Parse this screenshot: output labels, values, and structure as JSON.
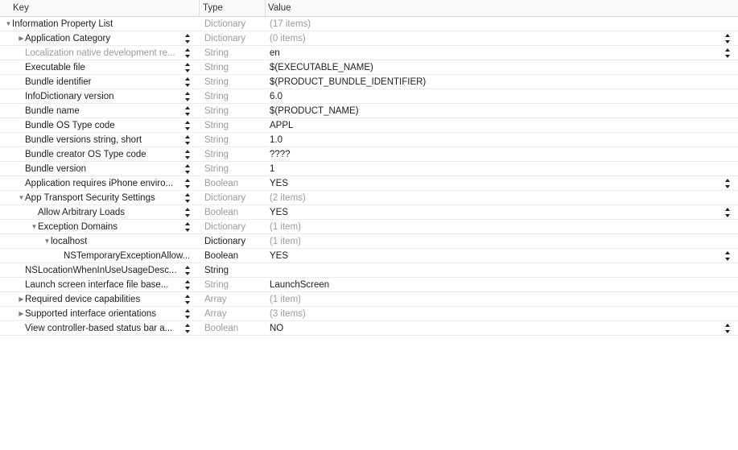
{
  "columns": {
    "key": "Key",
    "type": "Type",
    "value": "Value"
  },
  "rows": [
    {
      "key": "Information Property List",
      "type": "Dictionary",
      "value": "(17 items)",
      "level": 0,
      "disclosure": "expanded",
      "key_stepper": false,
      "value_stepper": false,
      "key_muted": false,
      "type_dark": false,
      "value_muted": true
    },
    {
      "key": "Application Category",
      "type": "Dictionary",
      "value": "(0 items)",
      "level": 1,
      "disclosure": "collapsed",
      "key_stepper": true,
      "value_stepper": true,
      "key_muted": false,
      "type_dark": false,
      "value_muted": true
    },
    {
      "key": "Localization native development re...",
      "type": "String",
      "value": "en",
      "level": 1,
      "disclosure": "none",
      "key_stepper": true,
      "value_stepper": true,
      "key_muted": true,
      "type_dark": false,
      "value_muted": false
    },
    {
      "key": "Executable file",
      "type": "String",
      "value": "$(EXECUTABLE_NAME)",
      "level": 1,
      "disclosure": "none",
      "key_stepper": true,
      "value_stepper": false,
      "key_muted": false,
      "type_dark": false,
      "value_muted": false
    },
    {
      "key": "Bundle identifier",
      "type": "String",
      "value": "$(PRODUCT_BUNDLE_IDENTIFIER)",
      "level": 1,
      "disclosure": "none",
      "key_stepper": true,
      "value_stepper": false,
      "key_muted": false,
      "type_dark": false,
      "value_muted": false
    },
    {
      "key": "InfoDictionary version",
      "type": "String",
      "value": "6.0",
      "level": 1,
      "disclosure": "none",
      "key_stepper": true,
      "value_stepper": false,
      "key_muted": false,
      "type_dark": false,
      "value_muted": false
    },
    {
      "key": "Bundle name",
      "type": "String",
      "value": "$(PRODUCT_NAME)",
      "level": 1,
      "disclosure": "none",
      "key_stepper": true,
      "value_stepper": false,
      "key_muted": false,
      "type_dark": false,
      "value_muted": false
    },
    {
      "key": "Bundle OS Type code",
      "type": "String",
      "value": "APPL",
      "level": 1,
      "disclosure": "none",
      "key_stepper": true,
      "value_stepper": false,
      "key_muted": false,
      "type_dark": false,
      "value_muted": false
    },
    {
      "key": "Bundle versions string, short",
      "type": "String",
      "value": "1.0",
      "level": 1,
      "disclosure": "none",
      "key_stepper": true,
      "value_stepper": false,
      "key_muted": false,
      "type_dark": false,
      "value_muted": false
    },
    {
      "key": "Bundle creator OS Type code",
      "type": "String",
      "value": "????",
      "level": 1,
      "disclosure": "none",
      "key_stepper": true,
      "value_stepper": false,
      "key_muted": false,
      "type_dark": false,
      "value_muted": false
    },
    {
      "key": "Bundle version",
      "type": "String",
      "value": "1",
      "level": 1,
      "disclosure": "none",
      "key_stepper": true,
      "value_stepper": false,
      "key_muted": false,
      "type_dark": false,
      "value_muted": false
    },
    {
      "key": "Application requires iPhone enviro...",
      "type": "Boolean",
      "value": "YES",
      "level": 1,
      "disclosure": "none",
      "key_stepper": true,
      "value_stepper": true,
      "key_muted": false,
      "type_dark": false,
      "value_muted": false
    },
    {
      "key": "App Transport Security Settings",
      "type": "Dictionary",
      "value": "(2 items)",
      "level": 1,
      "disclosure": "expanded",
      "key_stepper": true,
      "value_stepper": false,
      "key_muted": false,
      "type_dark": false,
      "value_muted": true
    },
    {
      "key": "Allow Arbitrary Loads",
      "type": "Boolean",
      "value": "YES",
      "level": 2,
      "disclosure": "none",
      "key_stepper": true,
      "value_stepper": true,
      "key_muted": false,
      "type_dark": false,
      "value_muted": false
    },
    {
      "key": "Exception Domains",
      "type": "Dictionary",
      "value": "(1 item)",
      "level": 2,
      "disclosure": "expanded",
      "key_stepper": true,
      "value_stepper": false,
      "key_muted": false,
      "type_dark": false,
      "value_muted": true
    },
    {
      "key": "localhost",
      "type": "Dictionary",
      "value": "(1 item)",
      "level": 3,
      "disclosure": "expanded",
      "key_stepper": false,
      "value_stepper": false,
      "key_muted": false,
      "type_dark": true,
      "value_muted": true
    },
    {
      "key": "NSTemporaryExceptionAllow...",
      "type": "Boolean",
      "value": "YES",
      "level": 4,
      "disclosure": "none",
      "key_stepper": false,
      "value_stepper": true,
      "key_muted": false,
      "type_dark": true,
      "value_muted": false
    },
    {
      "key": "NSLocationWhenInUseUsageDesc...",
      "type": "String",
      "value": "",
      "level": 1,
      "disclosure": "none",
      "key_stepper": true,
      "value_stepper": false,
      "key_muted": false,
      "type_dark": true,
      "value_muted": false
    },
    {
      "key": "Launch screen interface file base...",
      "type": "String",
      "value": "LaunchScreen",
      "level": 1,
      "disclosure": "none",
      "key_stepper": true,
      "value_stepper": false,
      "key_muted": false,
      "type_dark": false,
      "value_muted": false
    },
    {
      "key": "Required device capabilities",
      "type": "Array",
      "value": "(1 item)",
      "level": 1,
      "disclosure": "collapsed",
      "key_stepper": true,
      "value_stepper": false,
      "key_muted": false,
      "type_dark": false,
      "value_muted": true
    },
    {
      "key": "Supported interface orientations",
      "type": "Array",
      "value": "(3 items)",
      "level": 1,
      "disclosure": "collapsed",
      "key_stepper": true,
      "value_stepper": false,
      "key_muted": false,
      "type_dark": false,
      "value_muted": true
    },
    {
      "key": "View controller-based status bar a...",
      "type": "Boolean",
      "value": "NO",
      "level": 1,
      "disclosure": "none",
      "key_stepper": true,
      "value_stepper": true,
      "key_muted": false,
      "type_dark": false,
      "value_muted": false
    }
  ]
}
